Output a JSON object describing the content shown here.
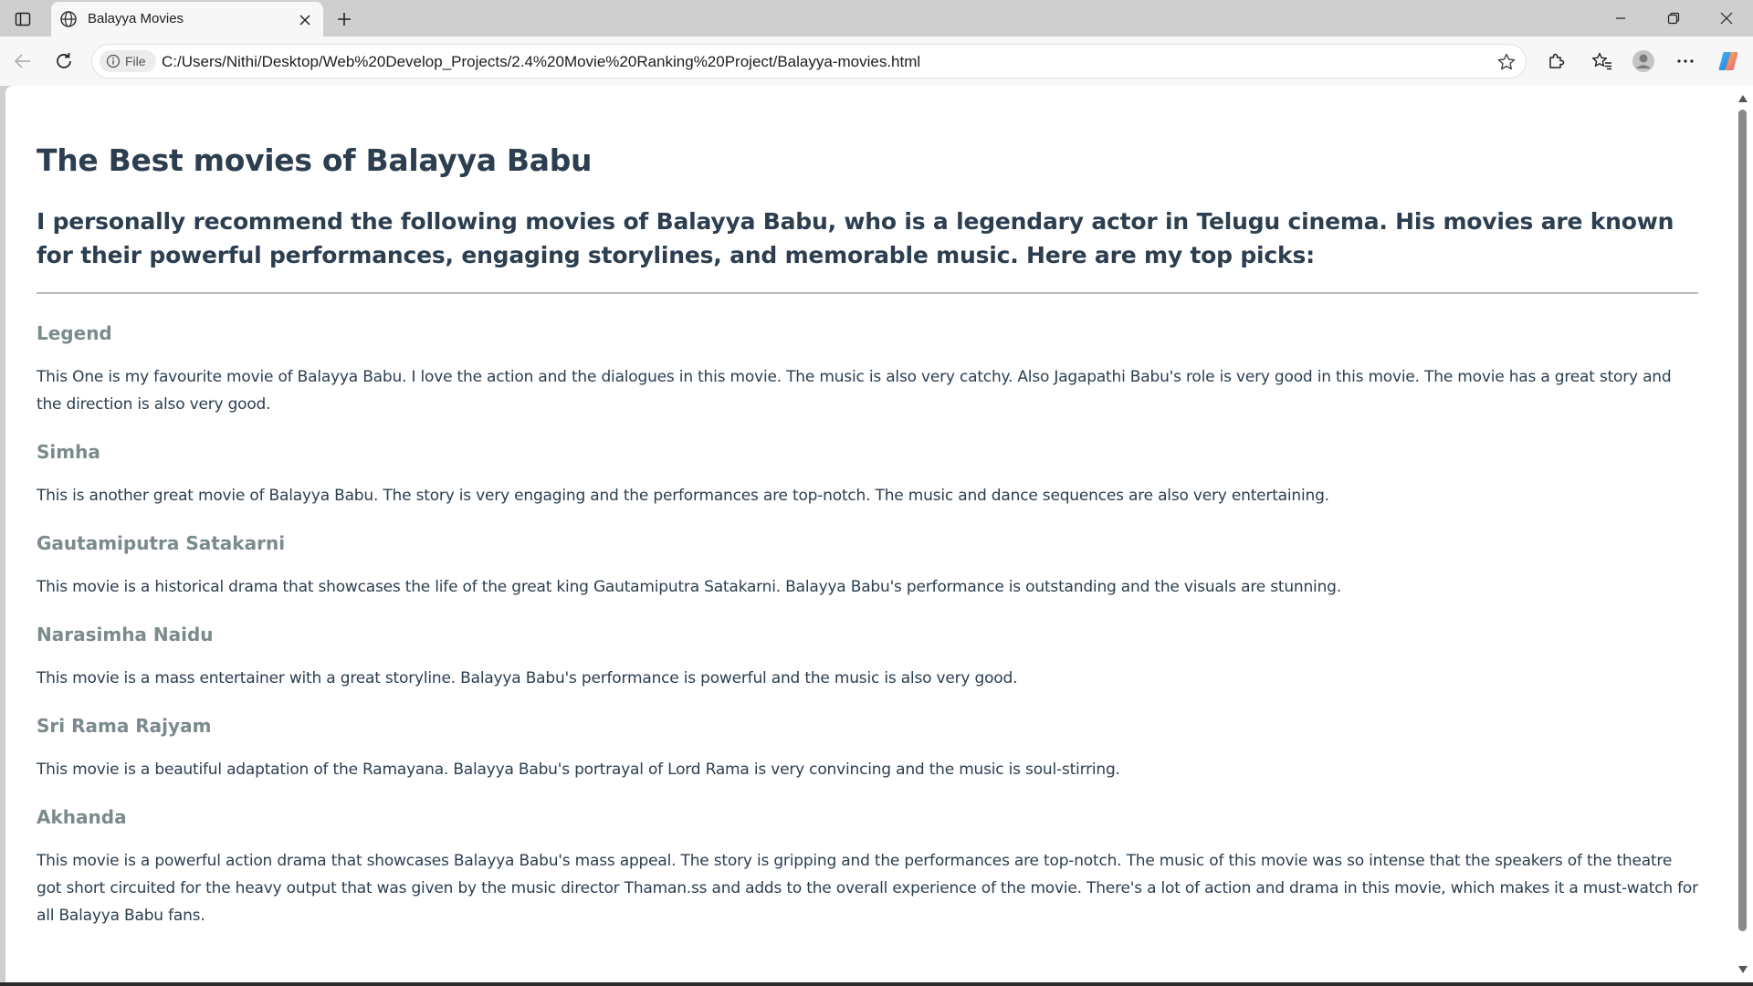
{
  "browser": {
    "tab_title": "Balayya Movies",
    "site_info_label": "File",
    "url": "C:/Users/Nithi/Desktop/Web%20Develop_Projects/2.4%20Movie%20Ranking%20Project/Balayya-movies.html"
  },
  "page": {
    "title": "The Best movies of Balayya Babu",
    "intro": "I personally recommend the following movies of Balayya Babu, who is a legendary actor in Telugu cinema. His movies are known for their powerful performances, engaging storylines, and memorable music. Here are my top picks:",
    "movies": [
      {
        "name": "Legend",
        "description": "This One is my favourite movie of Balayya Babu. I love the action and the dialogues in this movie. The music is also very catchy. Also Jagapathi Babu's role is very good in this movie. The movie has a great story and the direction is also very good."
      },
      {
        "name": "Simha",
        "description": "This is another great movie of Balayya Babu. The story is very engaging and the performances are top-notch. The music and dance sequences are also very entertaining."
      },
      {
        "name": "Gautamiputra Satakarni",
        "description": "This movie is a historical drama that showcases the life of the great king Gautamiputra Satakarni. Balayya Babu's performance is outstanding and the visuals are stunning."
      },
      {
        "name": "Narasimha Naidu",
        "description": "This movie is a mass entertainer with a great storyline. Balayya Babu's performance is powerful and the music is also very good."
      },
      {
        "name": "Sri Rama Rajyam",
        "description": "This movie is a beautiful adaptation of the Ramayana. Balayya Babu's portrayal of Lord Rama is very convincing and the music is soul-stirring."
      },
      {
        "name": "Akhanda",
        "description": "This movie is a powerful action drama that showcases Balayya Babu's mass appeal. The story is gripping and the performances are top-notch. The music of this movie was so intense that the speakers of the theatre got short circuited for the heavy output that was given by the music director Thaman.ss and adds to the overall experience of the movie. There's a lot of action and drama in this movie, which makes it a must-watch for all Balayya Babu fans."
      }
    ]
  },
  "colors": {
    "heading": "#2c3e50",
    "movie_title": "#7b8a8c",
    "chrome_bg": "#cfcfcf",
    "toolbar_bg": "#f7f7f7"
  },
  "icons": {
    "sidebar": "sidebar-toggle-icon",
    "favicon": "globe-icon",
    "tab_close": "close-icon",
    "new_tab": "plus-icon",
    "minimize": "minimize-icon",
    "restore": "restore-icon",
    "window_close": "close-icon",
    "back": "back-arrow-icon",
    "refresh": "refresh-icon",
    "site_info": "info-icon",
    "favorite": "star-icon",
    "extensions": "puzzle-icon",
    "favorites": "favorites-icon",
    "profile": "avatar-icon",
    "more": "ellipsis-icon",
    "copilot": "copilot-icon"
  }
}
